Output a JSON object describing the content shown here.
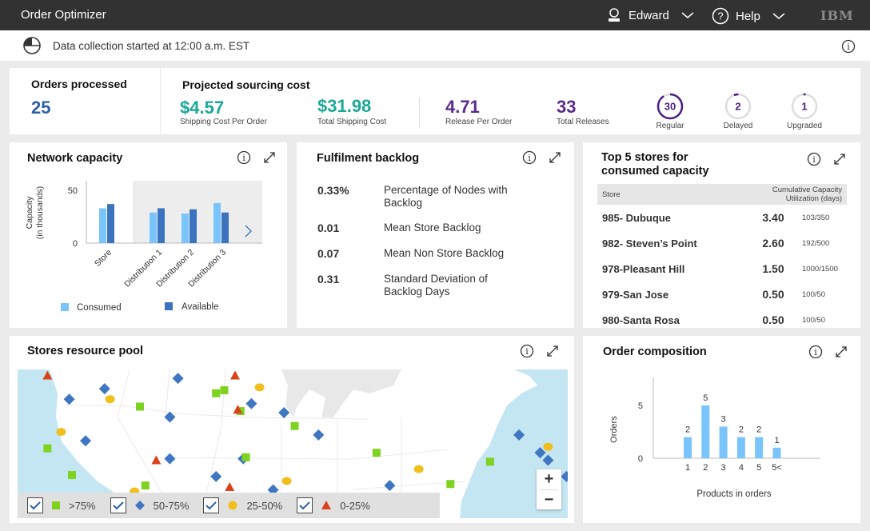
{
  "topbar": {
    "title": "Order Optimizer",
    "user": "Edward",
    "help": "Help",
    "brand": "IBM"
  },
  "subbar": {
    "status_text": "Data collection started at 12:00 a.m. EST"
  },
  "summary": {
    "orders_title": "Orders processed",
    "orders_value": "25",
    "cost_title": "Projected sourcing cost",
    "kpis": [
      {
        "value": "$4.57",
        "label": "Shipping Cost Per Order",
        "color": "#1aa898"
      },
      {
        "value": "$31.98",
        "label": "Total Shipping Cost",
        "color": "#1aa898"
      },
      {
        "value": "4.71",
        "label": "Release Per Order",
        "color": "#5a2a8c"
      },
      {
        "value": "33",
        "label": "Total Releases",
        "color": "#5a2a8c"
      }
    ],
    "rings": [
      {
        "value": "30",
        "label": "Regular",
        "fraction": 0.91
      },
      {
        "value": "2",
        "label": "Delayed",
        "fraction": 0.06
      },
      {
        "value": "1",
        "label": "Upgraded",
        "fraction": 0.03
      }
    ]
  },
  "network": {
    "title": "Network capacity",
    "ylabel_line1": "Capacity",
    "ylabel_line2": "(in thousands)",
    "legend_consumed": "Consumed",
    "legend_available": "Available"
  },
  "backlog": {
    "title": "Fulfilment backlog",
    "rows": [
      {
        "value": "0.33%",
        "label": "Percentage of Nodes with Backlog"
      },
      {
        "value": "0.01",
        "label": "Mean Store Backlog"
      },
      {
        "value": "0.07",
        "label": "Mean Non Store Backlog"
      },
      {
        "value": "0.31",
        "label": "Standard Deviation of Backlog Days"
      }
    ]
  },
  "top_stores": {
    "title_line1": "Top 5 stores for",
    "title_line2": "consumed capacity",
    "col_store": "Store",
    "col_util": "Cumulative Capacity Utilization (days)",
    "rows": [
      {
        "store": "985- Dubuque",
        "value": "3.40",
        "fraction": "103/350"
      },
      {
        "store": "982- Steven’s Point",
        "value": "2.60",
        "fraction": "192/500"
      },
      {
        "store": "978-Pleasant Hill",
        "value": "1.50",
        "fraction": "1000/1500"
      },
      {
        "store": "979-San Jose",
        "value": "0.50",
        "fraction": "100/50"
      },
      {
        "store": "980-Santa Rosa",
        "value": "0.50",
        "fraction": "100/50"
      }
    ]
  },
  "map": {
    "title": "Stores resource pool",
    "legend": [
      {
        "label": ">75%",
        "shape": "square",
        "color": "#7ed321",
        "checked": true
      },
      {
        "label": "50-75%",
        "shape": "diamond",
        "color": "#3e76c2",
        "checked": true
      },
      {
        "label": "25-50%",
        "shape": "circle",
        "color": "#f1be1b",
        "checked": true
      },
      {
        "label": "0-25%",
        "shape": "triangle",
        "color": "#d9421a",
        "checked": true
      }
    ],
    "zoom_in": "+",
    "zoom_out": "−"
  },
  "order_comp": {
    "title": "Order composition"
  },
  "chart_data": [
    {
      "type": "bar",
      "title": "Network capacity",
      "xlabel": "",
      "ylabel": "Capacity (in thousands)",
      "categories": [
        "Store",
        "Distribution 1",
        "Distribution 2",
        "Distribution 3"
      ],
      "series": [
        {
          "name": "Consumed",
          "color": "#79c4fa",
          "values": [
            33,
            29,
            28,
            38
          ]
        },
        {
          "name": "Available",
          "color": "#3b73bf",
          "values": [
            37,
            33,
            32,
            29
          ]
        }
      ],
      "yticks": [
        0,
        50
      ],
      "ylim": [
        0,
        55
      ],
      "legend": "bottom"
    },
    {
      "type": "bar",
      "title": "Order composition",
      "xlabel": "Products in orders",
      "ylabel": "Orders",
      "categories": [
        "1",
        "2",
        "3",
        "4",
        "5",
        "5<"
      ],
      "values": [
        2,
        5,
        3,
        2,
        2,
        1
      ],
      "yticks": [
        0,
        5
      ],
      "ylim": [
        0,
        7.5
      ],
      "color": "#79c4fa"
    }
  ],
  "map_markers": [
    {
      "t": "triangle",
      "x": 0.11,
      "y": 0.04
    },
    {
      "t": "diamond",
      "x": 0.19,
      "y": 0.2
    },
    {
      "t": "diamond",
      "x": 0.32,
      "y": 0.13
    },
    {
      "t": "circle",
      "x": 0.34,
      "y": 0.2
    },
    {
      "t": "diamond",
      "x": 0.59,
      "y": 0.06
    },
    {
      "t": "square",
      "x": 0.45,
      "y": 0.25
    },
    {
      "t": "diamond",
      "x": 0.56,
      "y": 0.32
    },
    {
      "t": "square",
      "x": 0.73,
      "y": 0.16
    },
    {
      "t": "circle",
      "x": 0.16,
      "y": 0.42
    },
    {
      "t": "square",
      "x": 0.11,
      "y": 0.53
    },
    {
      "t": "diamond",
      "x": 0.25,
      "y": 0.48
    },
    {
      "t": "square",
      "x": 0.2,
      "y": 0.71
    },
    {
      "t": "triangle",
      "x": 0.51,
      "y": 0.61
    },
    {
      "t": "diamond",
      "x": 0.56,
      "y": 0.6
    },
    {
      "t": "circle",
      "x": 0.43,
      "y": 0.82
    },
    {
      "t": "square",
      "x": 0.47,
      "y": 0.78
    },
    {
      "t": "diamond",
      "x": 0.73,
      "y": 0.72
    },
    {
      "t": "triangle",
      "x": 0.78,
      "y": 0.79
    },
    {
      "t": "square",
      "x": 0.82,
      "y": 0.28
    },
    {
      "t": "triangle",
      "x": 0.8,
      "y": 0.04
    },
    {
      "t": "square",
      "x": 0.76,
      "y": 0.14
    },
    {
      "t": "triangle",
      "x": 0.81,
      "y": 0.27
    },
    {
      "t": "circle",
      "x": 0.89,
      "y": 0.12
    },
    {
      "t": "diamond",
      "x": 0.86,
      "y": 0.23
    },
    {
      "t": "diamond",
      "x": 0.83,
      "y": 0.6
    },
    {
      "t": "square",
      "x": 0.84,
      "y": 0.59
    },
    {
      "t": "diamond",
      "x": 0.94,
      "y": 0.81
    },
    {
      "t": "circle",
      "x": 0.99,
      "y": 0.75
    },
    {
      "t": "diamond",
      "x": 0.98,
      "y": 0.29
    }
  ],
  "map_markers_east": [
    {
      "t": "square",
      "x": 0.02,
      "y": 0.38
    },
    {
      "t": "diamond",
      "x": 0.11,
      "y": 0.44
    },
    {
      "t": "square",
      "x": 0.33,
      "y": 0.56
    },
    {
      "t": "circle",
      "x": 0.49,
      "y": 0.67
    },
    {
      "t": "diamond",
      "x": 0.38,
      "y": 0.78
    },
    {
      "t": "diamond",
      "x": 0.28,
      "y": 0.91
    },
    {
      "t": "square",
      "x": 0.61,
      "y": 0.77
    },
    {
      "t": "square",
      "x": 0.76,
      "y": 0.62
    },
    {
      "t": "diamond",
      "x": 0.87,
      "y": 0.44
    },
    {
      "t": "diamond",
      "x": 0.95,
      "y": 0.56
    },
    {
      "t": "circle",
      "x": 0.98,
      "y": 0.52
    },
    {
      "t": "diamond",
      "x": 0.98,
      "y": 0.61
    },
    {
      "t": "diamond",
      "x": 1.05,
      "y": 0.72
    }
  ]
}
